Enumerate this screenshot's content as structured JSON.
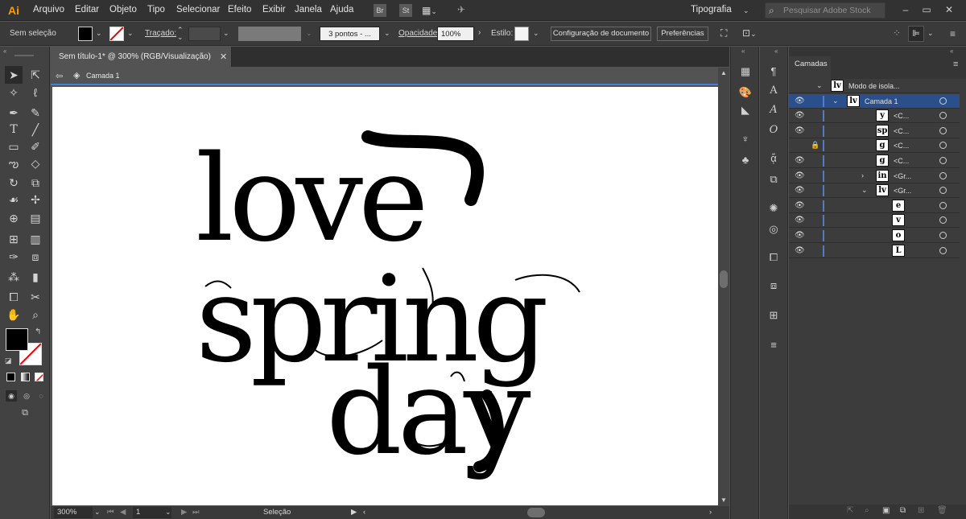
{
  "app": {
    "logo": "Ai",
    "workspace": "Tipografia"
  },
  "menus": [
    "Arquivo",
    "Editar",
    "Objeto",
    "Tipo",
    "Selecionar",
    "Efeito",
    "Exibir",
    "Janela",
    "Ajuda"
  ],
  "menubar_icons": {
    "bridge": "Br",
    "stock": "St"
  },
  "search": {
    "placeholder": "Pesquisar Adobe Stock"
  },
  "control": {
    "selection": "Sem seleção",
    "stroke_label": "Traçado:",
    "brush": "3 pontos - ...",
    "opacity_label": "Opacidade:",
    "opacity_value": "100%",
    "style_label": "Estilo:",
    "doc_setup": "Configuração de documento",
    "prefs": "Preferências"
  },
  "doc": {
    "tab_title": "Sem título-1* @ 300% (RGB/Visualização)",
    "layer_crumb": "Camada 1"
  },
  "artwork": {
    "line1": "love",
    "line2": "spring",
    "line3": "day"
  },
  "status": {
    "zoom": "300%",
    "artboard": "1",
    "tool": "Seleção"
  },
  "layers": {
    "title": "Camadas",
    "rows": [
      {
        "name": "Modo de isola...",
        "thumb": "lv"
      },
      {
        "name": "Camada 1",
        "thumb": "lv"
      },
      {
        "name": "<C...",
        "thumb": "y"
      },
      {
        "name": "<C...",
        "thumb": "sp"
      },
      {
        "name": "<C...",
        "thumb": "g"
      },
      {
        "name": "<C...",
        "thumb": "g"
      },
      {
        "name": "<Gr...",
        "thumb": "in"
      },
      {
        "name": "<Gr...",
        "thumb": "lv"
      },
      {
        "name": "",
        "thumb": "e"
      },
      {
        "name": "",
        "thumb": "v"
      },
      {
        "name": "",
        "thumb": "o"
      },
      {
        "name": "",
        "thumb": "L"
      }
    ]
  },
  "colors": {
    "accent": "#4d7bd2",
    "logo": "#ff9a00",
    "canvas": "#ffffff",
    "fill": "#000000"
  }
}
